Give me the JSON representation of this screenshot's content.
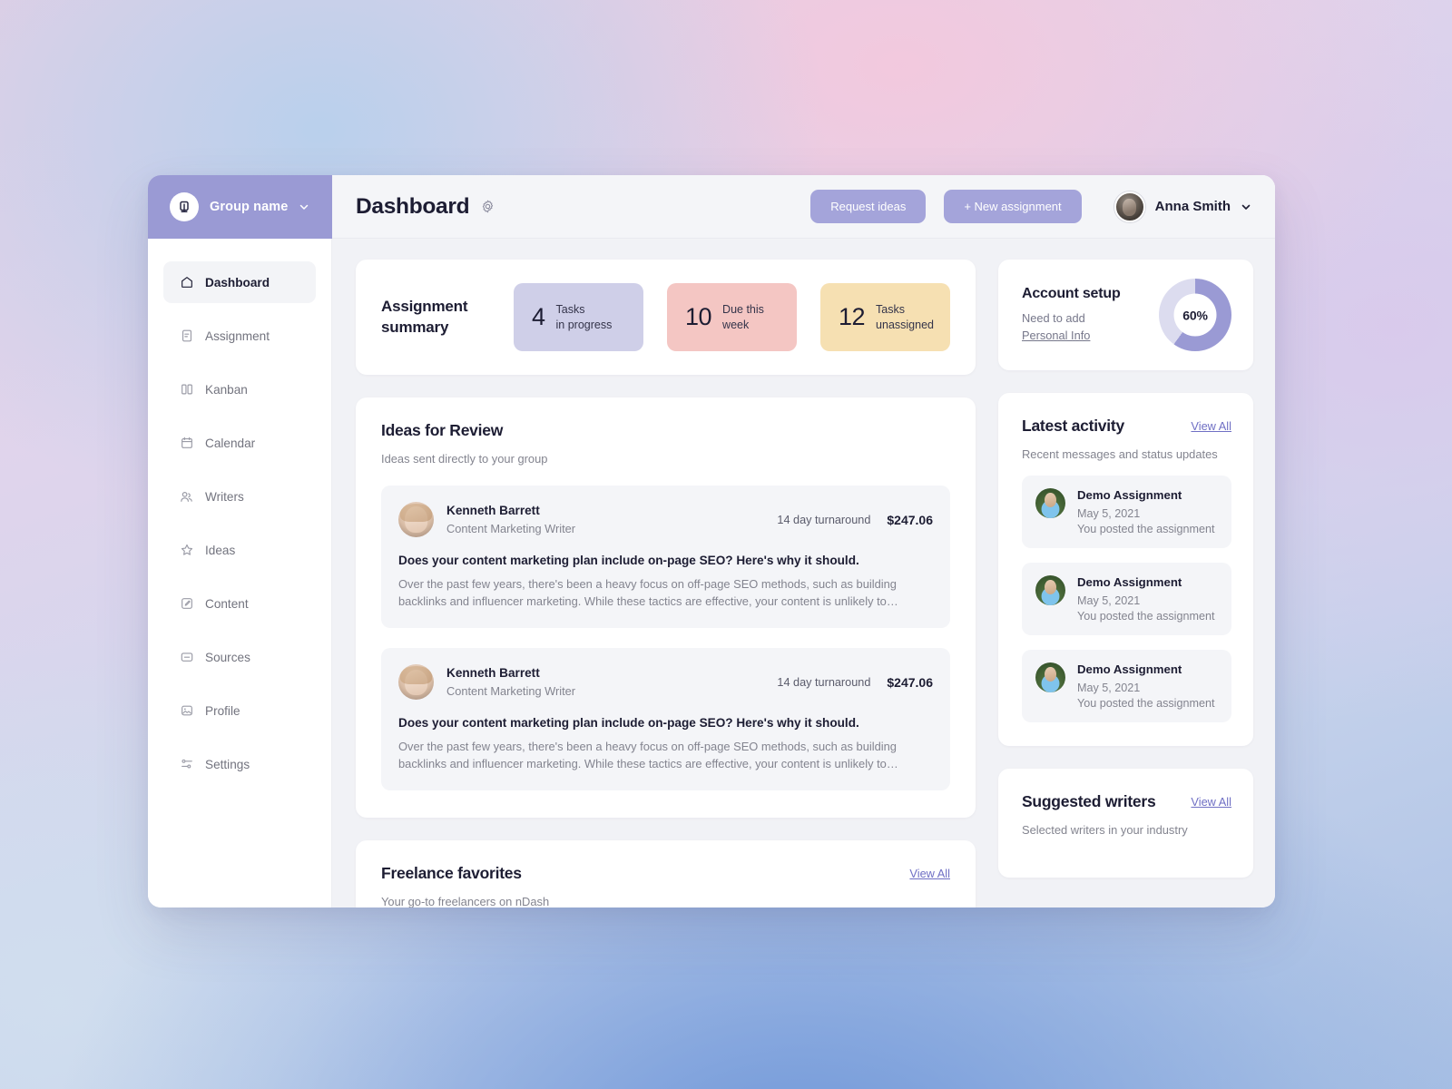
{
  "brand": {
    "name": "Group name",
    "logo_letter": "n",
    "caret_icon": "chevron-down-icon"
  },
  "header": {
    "title": "Dashboard",
    "gear_icon": "gear-icon",
    "request_ideas_label": "Request ideas",
    "new_assignment_label": "+ New assignment",
    "user_name": "Anna Smith",
    "accent": "#a4a4da"
  },
  "sidebar": {
    "items": [
      {
        "label": "Dashboard",
        "icon": "home-icon",
        "active": true
      },
      {
        "label": "Assignment",
        "icon": "document-icon",
        "active": false
      },
      {
        "label": "Kanban",
        "icon": "columns-icon",
        "active": false
      },
      {
        "label": "Calendar",
        "icon": "calendar-icon",
        "active": false
      },
      {
        "label": "Writers",
        "icon": "users-icon",
        "active": false
      },
      {
        "label": "Ideas",
        "icon": "star-icon",
        "active": false
      },
      {
        "label": "Content",
        "icon": "edit-icon",
        "active": false
      },
      {
        "label": "Sources",
        "icon": "folder-icon",
        "active": false
      },
      {
        "label": "Profile",
        "icon": "image-icon",
        "active": false
      },
      {
        "label": "Settings",
        "icon": "sliders-icon",
        "active": false
      }
    ]
  },
  "assignment_summary": {
    "title": "Assignment summary",
    "stats": [
      {
        "value": "4",
        "label_line1": "Tasks",
        "label_line2": "in progress",
        "color": "#cfcfe8"
      },
      {
        "value": "10",
        "label_line1": "Due this",
        "label_line2": "week",
        "color": "#f4c6c3"
      },
      {
        "value": "12",
        "label_line1": "Tasks",
        "label_line2": "unassigned",
        "color": "#f6e0b2"
      }
    ]
  },
  "account_setup": {
    "title": "Account setup",
    "need_text": "Need to add",
    "link_text": "Personal Info",
    "percent_label": "60%",
    "percent_value": 60,
    "progress_color": "#9a9ad4",
    "track_color": "#dcdcef"
  },
  "ideas_for_review": {
    "title": "Ideas for Review",
    "subtitle": "Ideas sent directly to your group",
    "items": [
      {
        "author": "Kenneth Barrett",
        "role": "Content Marketing Writer",
        "turnaround": "14 day turnaround",
        "price": "$247.06",
        "headline": "Does your content marketing plan include on-page SEO? Here's why it should.",
        "body": "Over the past few years, there's been a heavy focus on off-page SEO methods, such as building backlinks and influencer marketing. While these tactics are effective, your content is unlikely to…"
      },
      {
        "author": "Kenneth Barrett",
        "role": "Content Marketing Writer",
        "turnaround": "14 day turnaround",
        "price": "$247.06",
        "headline": "Does your content marketing plan include on-page SEO? Here's why it should.",
        "body": "Over the past few years, there's been a heavy focus on off-page SEO methods, such as building backlinks and influencer marketing. While these tactics are effective, your content is unlikely to…"
      }
    ]
  },
  "latest_activity": {
    "title": "Latest activity",
    "view_all": "View All",
    "subtitle": "Recent messages and status updates",
    "items": [
      {
        "title": "Demo Assignment",
        "date": "May 5, 2021",
        "desc": "You posted the assignment"
      },
      {
        "title": "Demo Assignment",
        "date": "May 5, 2021",
        "desc": "You posted the assignment"
      },
      {
        "title": "Demo Assignment",
        "date": "May 5, 2021",
        "desc": "You posted the assignment"
      }
    ]
  },
  "freelance_favorites": {
    "title": "Freelance favorites",
    "view_all": "View All",
    "subtitle": "Your go-to freelancers on nDash"
  },
  "suggested_writers": {
    "title": "Suggested writers",
    "view_all": "View All",
    "subtitle": "Selected writers in your industry"
  }
}
